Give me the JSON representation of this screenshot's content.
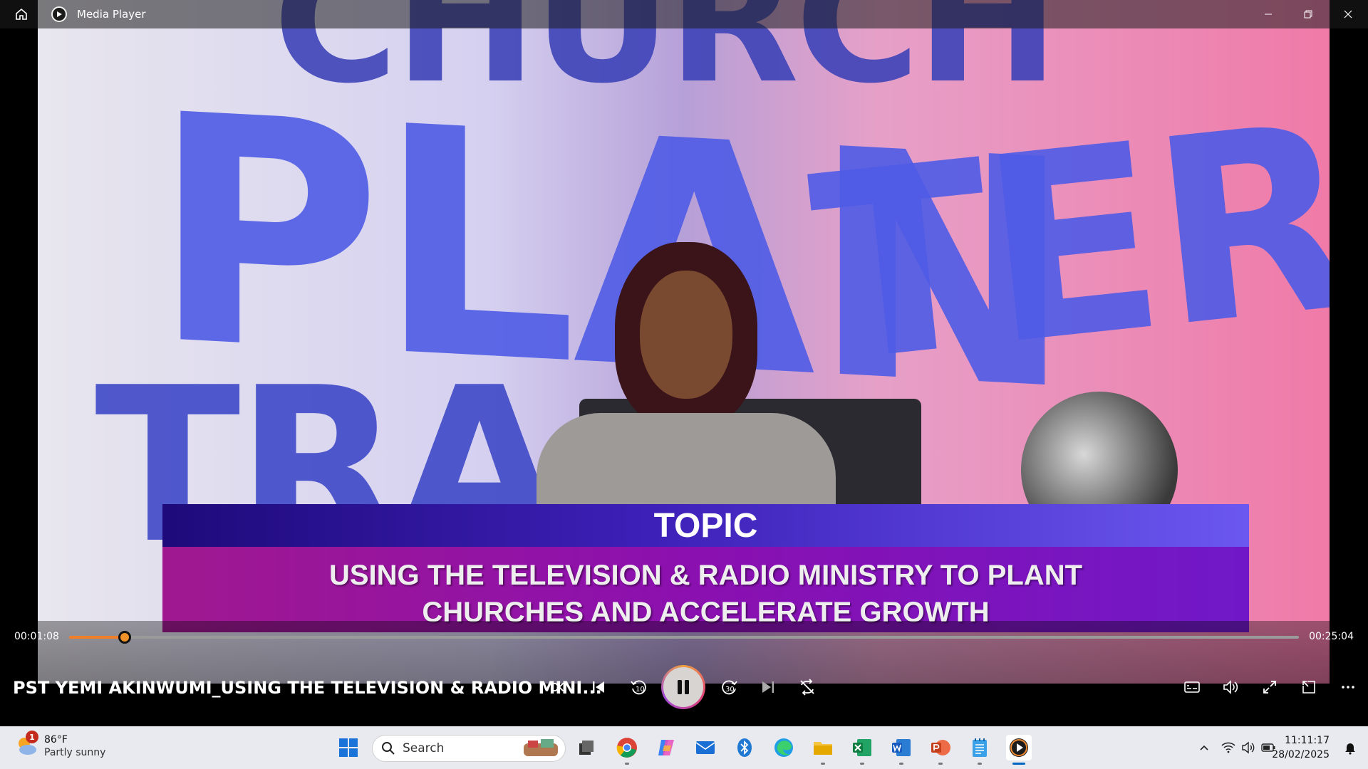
{
  "window": {
    "title": "Media Player",
    "minimize_label": "Minimize",
    "maximize_label": "Restore",
    "close_label": "Close"
  },
  "video": {
    "topic_heading": "TOPIC",
    "topic_line1": "USING THE TELEVISION & RADIO MINISTRY TO PLANT",
    "topic_line2": "CHURCHES AND ACCELERATE GROWTH",
    "bg_text": [
      "CHURCH",
      "PLAN",
      "TERS",
      "TRA"
    ]
  },
  "player": {
    "current_time": "00:01:08",
    "duration": "00:25:04",
    "progress": 0.0452,
    "media_title": "PST YEMI AKINWUMI_USING THE TELEVISION & RADIO MINI...",
    "skip_back_seconds": "10",
    "skip_forward_seconds": "30",
    "accent_color": "#f07f2a"
  },
  "taskbar": {
    "weather_temp": "86°F",
    "weather_condition": "Partly sunny",
    "weather_badge": "1",
    "search_placeholder": "Search",
    "time": "11:11:17",
    "date": "28/02/2025"
  }
}
